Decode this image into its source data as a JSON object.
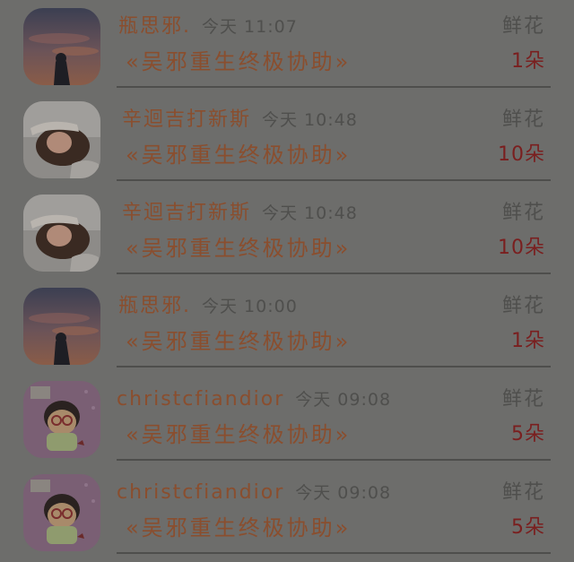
{
  "records": [
    {
      "name": "瓶思邪.",
      "time": "今天 11:07",
      "book": "«吴邪重生终极协助»",
      "gift": "鲜花",
      "count": "1朵",
      "avatar": "sunset-avatar"
    },
    {
      "name": "辛迴吉打新斯",
      "time": "今天 10:48",
      "book": "«吴邪重生终极协助»",
      "gift": "鲜花",
      "count": "10朵",
      "avatar": "lying-girl-avatar"
    },
    {
      "name": "辛迴吉打新斯",
      "time": "今天 10:48",
      "book": "«吴邪重生终极协助»",
      "gift": "鲜花",
      "count": "10朵",
      "avatar": "lying-girl-avatar"
    },
    {
      "name": "瓶思邪.",
      "time": "今天 10:00",
      "book": "«吴邪重生终极协助»",
      "gift": "鲜花",
      "count": "1朵",
      "avatar": "sunset-avatar"
    },
    {
      "name": "christcfiandior",
      "time": "今天 09:08",
      "book": "«吴邪重生终极协助»",
      "gift": "鲜花",
      "count": "5朵",
      "avatar": "cartoon-kid-avatar"
    },
    {
      "name": "christcfiandior",
      "time": "今天 09:08",
      "book": "«吴邪重生终极协助»",
      "gift": "鲜花",
      "count": "5朵",
      "avatar": "cartoon-kid-avatar"
    }
  ]
}
